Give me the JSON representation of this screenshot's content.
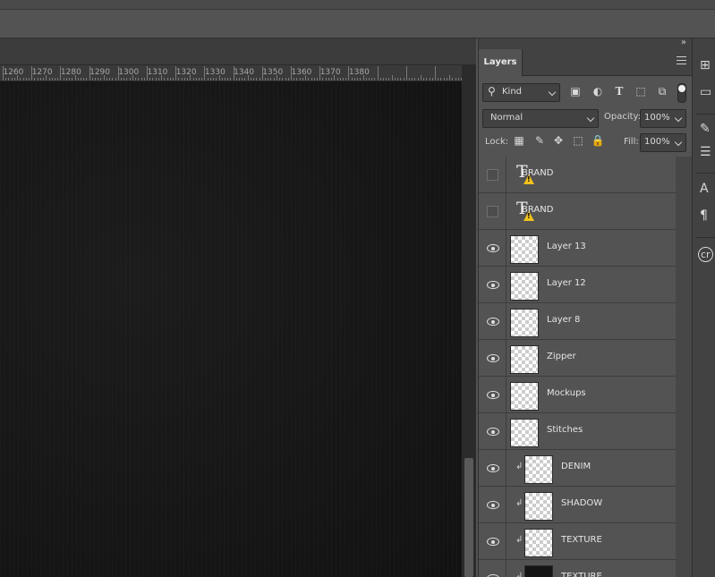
{
  "ruler": {
    "labels": [
      "1260",
      "1270",
      "1280",
      "1290",
      "1300",
      "1310",
      "1320",
      "1330",
      "1340",
      "1350",
      "1360",
      "1370",
      "1380"
    ]
  },
  "panel": {
    "collapse_icon": "»",
    "tab_label": "Layers",
    "filter": {
      "label": "Kind",
      "icons": [
        "image-filter-icon",
        "adjustment-filter-icon",
        "type-filter-icon",
        "shape-filter-icon",
        "smart-object-filter-icon"
      ]
    },
    "blend_mode": "Normal",
    "opacity_label": "Opacity:",
    "opacity_value": "100%",
    "lock_label": "Lock:",
    "fill_label": "Fill:",
    "fill_value": "100%"
  },
  "layers": [
    {
      "name": "BRAND",
      "kind": "type",
      "visible": false,
      "clipped": false
    },
    {
      "name": "BRAND",
      "kind": "type",
      "visible": false,
      "clipped": false
    },
    {
      "name": "Layer 13",
      "kind": "pixel",
      "visible": true,
      "clipped": false
    },
    {
      "name": "Layer 12",
      "kind": "pixel",
      "visible": true,
      "clipped": false
    },
    {
      "name": "Layer 8",
      "kind": "pixel",
      "visible": true,
      "clipped": false
    },
    {
      "name": "Zipper",
      "kind": "pixel",
      "visible": true,
      "clipped": false
    },
    {
      "name": "Mockups",
      "kind": "pixel",
      "visible": true,
      "clipped": false
    },
    {
      "name": "Stitches",
      "kind": "pixel",
      "visible": true,
      "clipped": false
    },
    {
      "name": "DENIM",
      "kind": "pixel",
      "visible": true,
      "clipped": true
    },
    {
      "name": "SHADOW",
      "kind": "pixel",
      "visible": true,
      "clipped": true
    },
    {
      "name": "TEXTURE",
      "kind": "pixel",
      "visible": true,
      "clipped": true
    },
    {
      "name": "TEXTURE",
      "kind": "dark",
      "visible": true,
      "clipped": true
    }
  ],
  "clip_glyph": "↲",
  "right_toolbar": {
    "items": [
      "history-icon",
      "comment-icon",
      "brush-settings-icon",
      "adjustments-icon",
      "character-icon",
      "paragraph-icon",
      "creative-cloud-icon"
    ],
    "glyphs": [
      "⊞",
      "▭",
      "✎",
      "☰",
      "A",
      "¶",
      "cr"
    ]
  },
  "colors": {
    "canvas": "#141414",
    "panel": "#535353",
    "warning": "#f2c21b"
  }
}
